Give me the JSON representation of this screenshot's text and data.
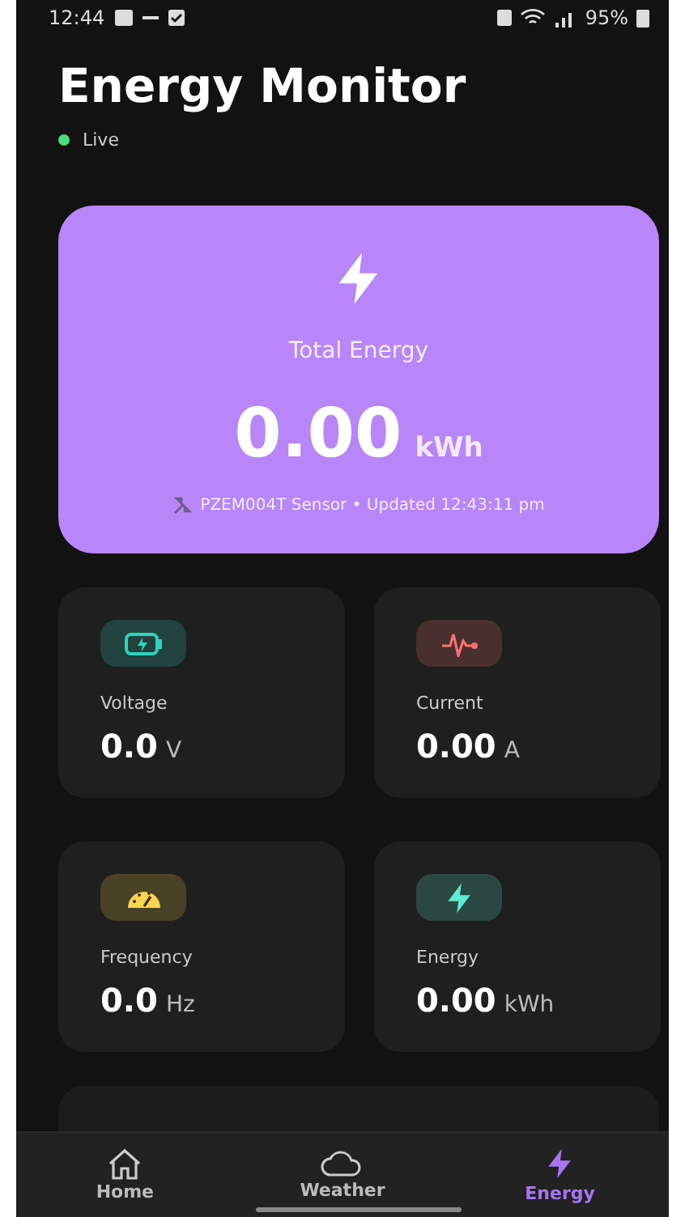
{
  "status_bar": {
    "time": "12:44",
    "battery": "95%"
  },
  "header": {
    "title": "Energy Monitor",
    "status": {
      "label": "Live",
      "color": "#4ade80"
    }
  },
  "hero": {
    "label": "Total Energy",
    "value": "0.00",
    "unit": "kWh",
    "footer": "PZEM004T Sensor • Updated 12:43:11 pm"
  },
  "metrics": [
    {
      "kind": "voltage",
      "label": "Voltage",
      "value": "0.0",
      "unit": "V",
      "color": "#2dd4bf"
    },
    {
      "kind": "current",
      "label": "Current",
      "value": "0.00",
      "unit": "A",
      "color": "#f87171"
    },
    {
      "kind": "frequency",
      "label": "Frequency",
      "value": "0.0",
      "unit": "Hz",
      "color": "#fcd34d"
    },
    {
      "kind": "energy",
      "label": "Energy",
      "value": "0.00",
      "unit": "kWh",
      "color": "#5eead4"
    }
  ],
  "nav": [
    {
      "kind": "home",
      "label": "Home",
      "selected": false
    },
    {
      "kind": "weather",
      "label": "Weather",
      "selected": false
    },
    {
      "kind": "energy",
      "label": "Energy",
      "selected": true
    }
  ]
}
